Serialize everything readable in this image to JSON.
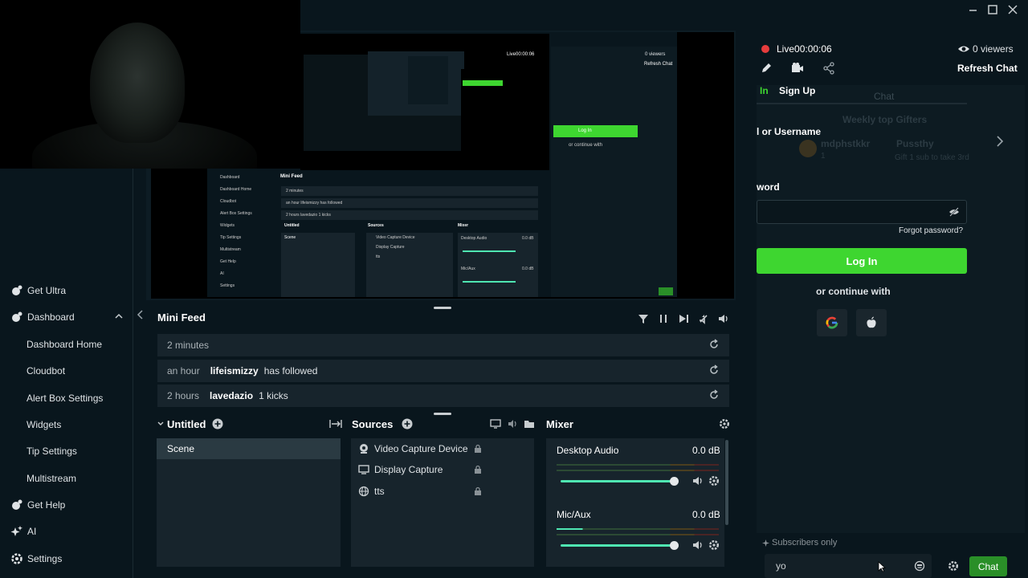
{
  "sidebar": {
    "items": [
      {
        "label": "Get Ultra",
        "icon": "ultra-icon"
      },
      {
        "label": "Dashboard",
        "icon": "dashboard-icon"
      },
      {
        "label": "Dashboard Home"
      },
      {
        "label": "Cloudbot"
      },
      {
        "label": "Alert Box Settings"
      },
      {
        "label": "Widgets"
      },
      {
        "label": "Tip Settings"
      },
      {
        "label": "Multistream"
      },
      {
        "label": "Get Help",
        "icon": "help-icon"
      },
      {
        "label": "AI",
        "icon": "ai-sparkle-icon"
      },
      {
        "label": "Settings",
        "icon": "settings-gear-icon"
      }
    ]
  },
  "minifeed": {
    "title": "Mini Feed",
    "rows": [
      {
        "time": "2 minutes",
        "user": "",
        "message": ""
      },
      {
        "time": "an hour",
        "user": "lifeismizzy",
        "message": "has followed"
      },
      {
        "time": "2 hours",
        "user": "lavedazio",
        "message": "1 kicks"
      }
    ]
  },
  "scenes": {
    "title": "Untitled",
    "items": [
      "Scene"
    ]
  },
  "sources": {
    "title": "Sources",
    "items": [
      {
        "label": "Video Capture Device",
        "icon": "camera-icon"
      },
      {
        "label": "Display Capture",
        "icon": "monitor-icon"
      },
      {
        "label": "tts",
        "icon": "globe-icon"
      }
    ]
  },
  "mixer": {
    "title": "Mixer",
    "channels": [
      {
        "name": "Desktop Audio",
        "db": "0.0 dB",
        "volume": 1.0
      },
      {
        "name": "Mic/Aux",
        "db": "0.0 dB",
        "volume": 1.0
      }
    ]
  },
  "chat": {
    "live_label": "Live",
    "live_time": "00:00:06",
    "viewers": "0 viewers",
    "refresh": "Refresh Chat",
    "tab_login": "In",
    "tab_signup": "Sign Up",
    "overlay_chat": "Chat",
    "overlay_gifters": "Weekly top Gifters",
    "overlay_gifter1": "mdphstkkr",
    "overlay_gifter1_count": "1",
    "overlay_gifter2": "Pussthy",
    "overlay_gifter2_sub": "Gift 1 sub to take 3rd",
    "username_label": "l or Username",
    "password_label": "word",
    "forgot": "Forgot password?",
    "login_button": "Log In",
    "continue_with": "or continue with",
    "subscribers_only": "Subscribers only",
    "input_value": "yo",
    "chat_button": "Chat"
  },
  "preview": {
    "nested_live": "Live00:00:06",
    "nested_viewers": "0 viewers",
    "nested_refresh": "Refresh Chat",
    "nested_minifeed": "Mini Feed",
    "nested_login": "Log In",
    "nested_continue": "or continue with",
    "nested_sidebar": [
      "Dashboard",
      "Dashboard Home",
      "Cloudbot",
      "Alert Box Settings",
      "Widgets",
      "Tip Settings",
      "Multistream",
      "Get Help",
      "AI",
      "Settings"
    ],
    "nested_feed": [
      "2 minutes",
      "an hour  lifeismizzy  has followed",
      "2 hours  lavedazio  1 kicks"
    ],
    "nested_scene_title": "Untitled",
    "nested_scene": "Scene",
    "nested_sources_title": "Sources",
    "nested_sources": [
      "Video Capture Device",
      "Display Capture",
      "tts"
    ],
    "nested_mixer_title": "Mixer",
    "nested_mixer": [
      "Desktop Audio",
      "Mic/Aux"
    ],
    "nested_db": "0.0 dB"
  },
  "colors": {
    "accent_green": "#3ed630",
    "slider": "#4fe6b2",
    "live_red": "#e63c3c",
    "bg": "#09161d",
    "panel": "#17242c"
  }
}
